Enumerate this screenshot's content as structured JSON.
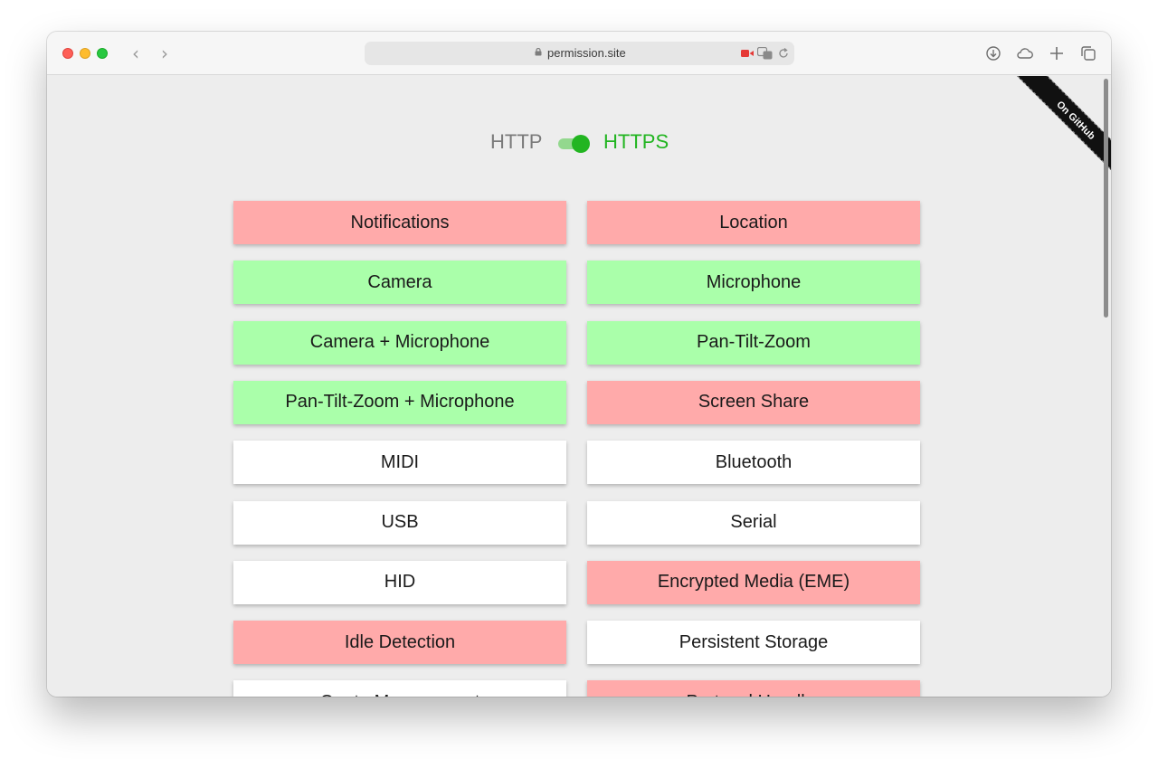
{
  "browser": {
    "url": "permission.site",
    "nav_back": "‹",
    "nav_forward": "›"
  },
  "ribbon": {
    "label": "On GitHub"
  },
  "toggle": {
    "left_label": "HTTP",
    "right_label": "HTTPS",
    "state": "HTTPS"
  },
  "colors": {
    "denied": "#ffaaaa",
    "granted": "#aaffaa",
    "default": "#ffffff",
    "https_green": "#22b521"
  },
  "permissions": [
    {
      "label": "Notifications",
      "status": "red"
    },
    {
      "label": "Location",
      "status": "red"
    },
    {
      "label": "Camera",
      "status": "green"
    },
    {
      "label": "Microphone",
      "status": "green"
    },
    {
      "label": "Camera + Microphone",
      "status": "green"
    },
    {
      "label": "Pan-Tilt-Zoom",
      "status": "green"
    },
    {
      "label": "Pan-Tilt-Zoom + Microphone",
      "status": "green"
    },
    {
      "label": "Screen Share",
      "status": "red"
    },
    {
      "label": "MIDI",
      "status": "white"
    },
    {
      "label": "Bluetooth",
      "status": "white"
    },
    {
      "label": "USB",
      "status": "white"
    },
    {
      "label": "Serial",
      "status": "white"
    },
    {
      "label": "HID",
      "status": "white"
    },
    {
      "label": "Encrypted Media (EME)",
      "status": "red"
    },
    {
      "label": "Idle Detection",
      "status": "red"
    },
    {
      "label": "Persistent Storage",
      "status": "white"
    },
    {
      "label": "Quota Management",
      "status": "white"
    },
    {
      "label": "Protocol Handler",
      "status": "red"
    }
  ]
}
